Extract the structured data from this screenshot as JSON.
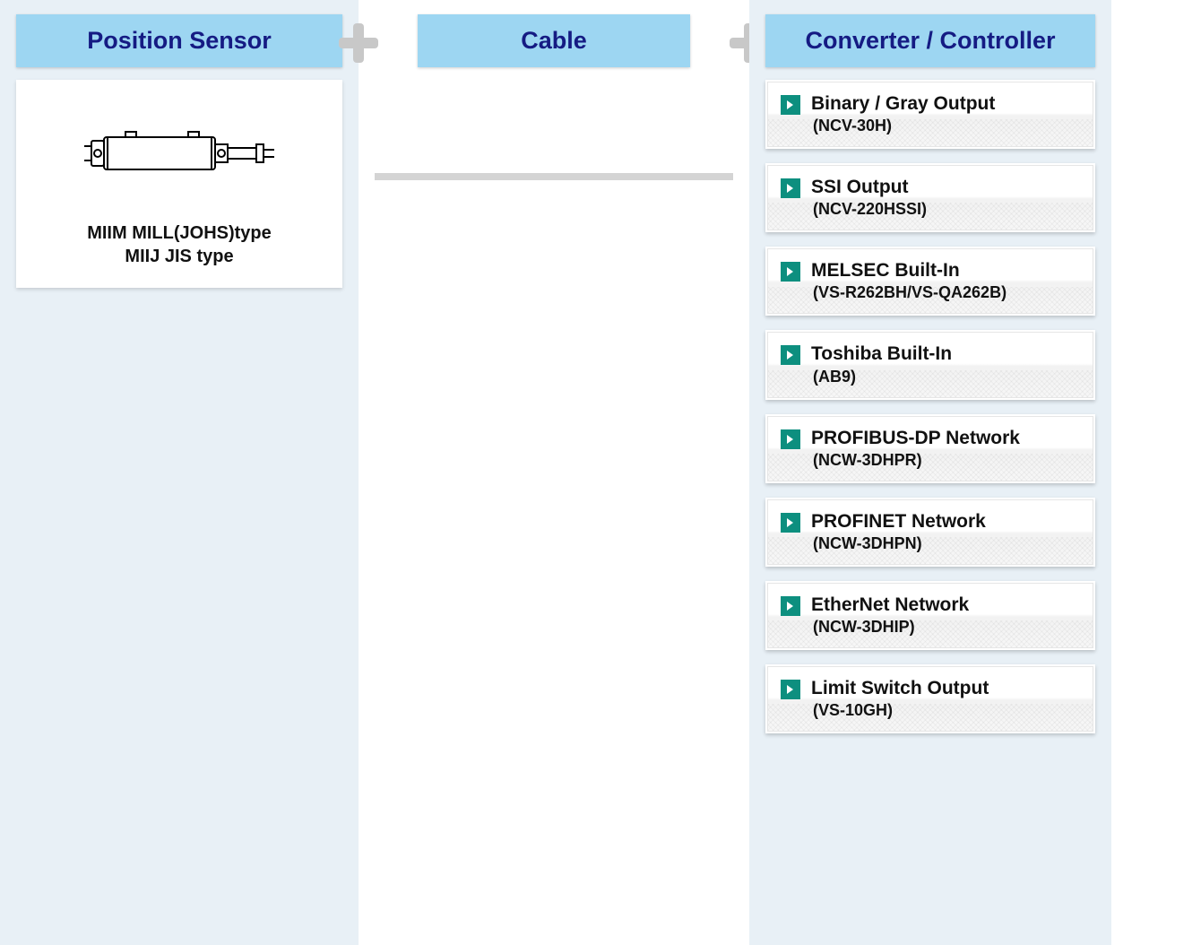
{
  "columns": {
    "left": {
      "title": "Position Sensor"
    },
    "middle": {
      "title": "Cable"
    },
    "right": {
      "title": "Converter / Controller"
    }
  },
  "sensor": {
    "line1": "MIIM MILL(JOHS)type",
    "line2": "MIIJ JIS type"
  },
  "converters": [
    {
      "title": "Binary / Gray Output",
      "model": "(NCV-30H)"
    },
    {
      "title": "SSI Output",
      "model": "(NCV-220HSSI)"
    },
    {
      "title": "MELSEC Built-In",
      "model": "(VS-R262BH/VS-QA262B)"
    },
    {
      "title": "Toshiba Built-In",
      "model": "(AB9)"
    },
    {
      "title": "PROFIBUS-DP Network",
      "model": "(NCW-3DHPR)"
    },
    {
      "title": "PROFINET Network",
      "model": "(NCW-3DHPN)"
    },
    {
      "title": "EtherNet Network",
      "model": "(NCW-3DHIP)"
    },
    {
      "title": "Limit Switch Output",
      "model": "(VS-10GH)"
    }
  ]
}
